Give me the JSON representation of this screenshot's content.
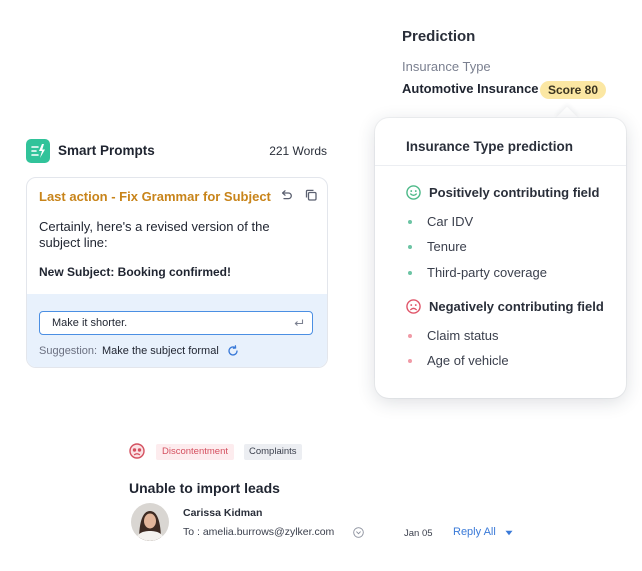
{
  "prediction": {
    "title": "Prediction",
    "label": "Insurance Type",
    "value": "Automotive Insurance",
    "score": "Score 80",
    "popover": {
      "title": "Insurance Type prediction",
      "positive": {
        "icon": "smile-face-icon",
        "color": "#4cb988",
        "title": "Positively contributing field",
        "items": [
          "Car IDV",
          "Tenure",
          "Third-party coverage"
        ]
      },
      "negative": {
        "icon": "frown-face-icon",
        "color": "#e0566a",
        "title": "Negatively contributing field",
        "items": [
          "Claim status",
          "Age of vehicle"
        ]
      }
    }
  },
  "smart_prompts": {
    "icon": "lightning-icon",
    "accent": "#31c39a",
    "title": "Smart Prompts",
    "word_count": "221 Words",
    "last_action": "Last action - Fix Grammar for Subject",
    "response": "Certainly, here's a revised version of the subject line:",
    "new_subject": "New Subject: Booking confirmed!",
    "input_value": "Make it shorter.",
    "suggestion_label": "Suggestion:",
    "suggestion_value": "Make the subject formal"
  },
  "email": {
    "sentiment_icon": "sad-face-icon",
    "tag_sentiment": "Discontentment",
    "tag_category": "Complaints",
    "subject": "Unable to import leads",
    "sender": "Carissa Kidman",
    "to": "To : amelia.burrows@zylker.com",
    "date": "Jan 05",
    "reply": "Reply All"
  }
}
